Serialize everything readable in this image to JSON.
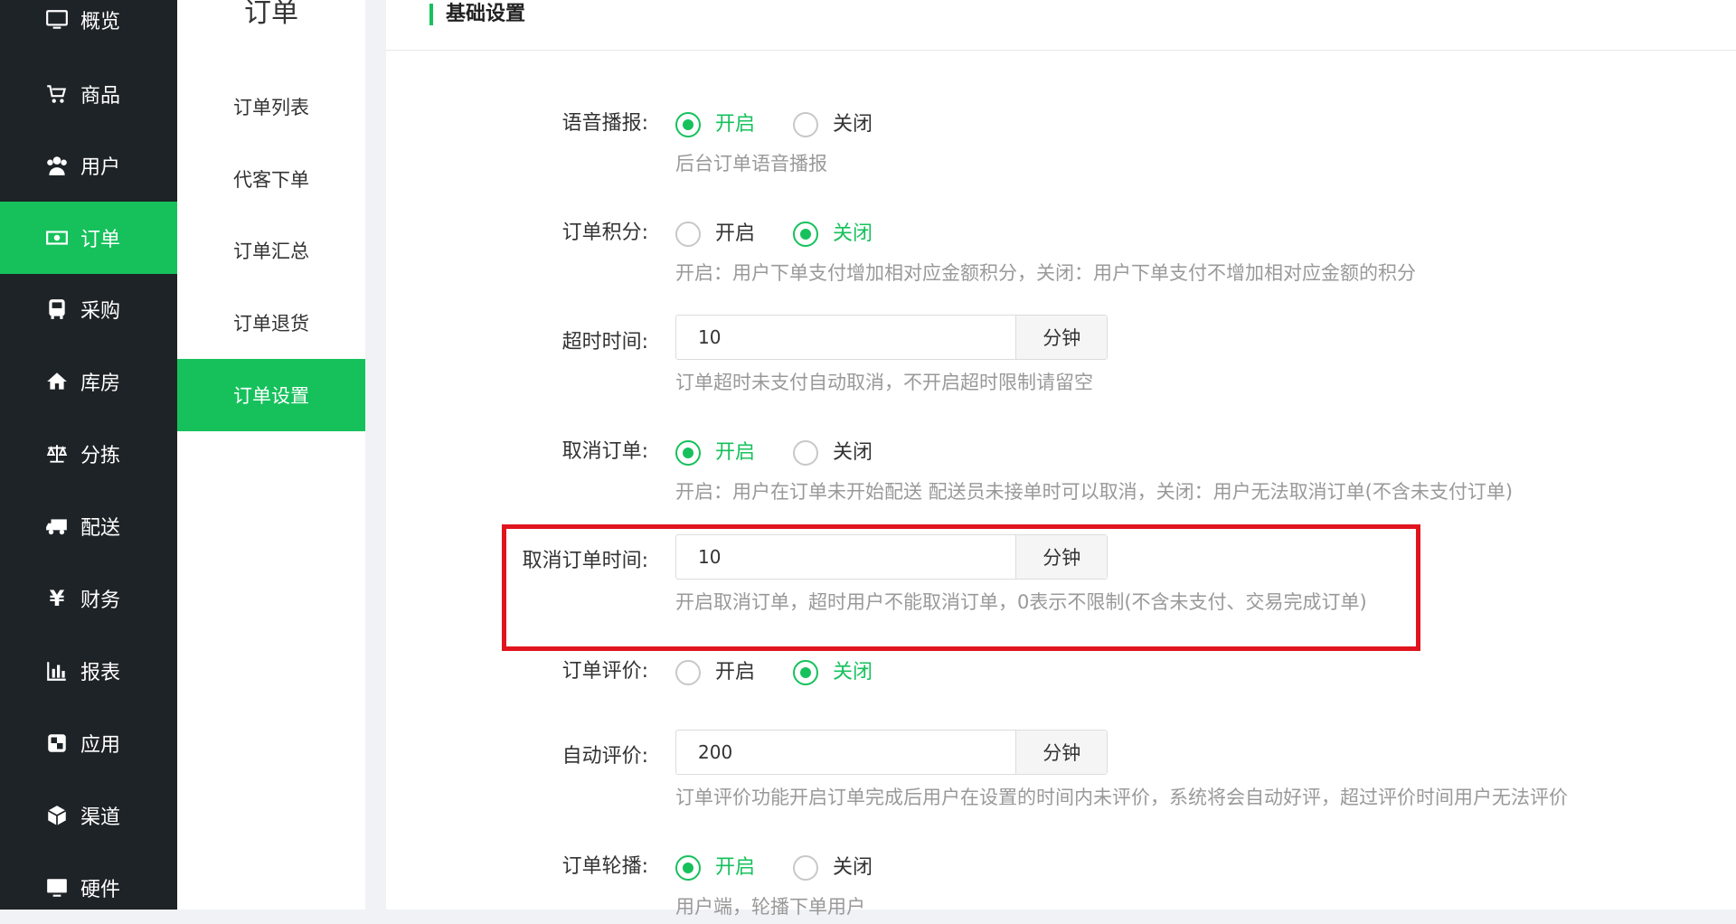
{
  "nav": {
    "items": [
      {
        "label": "概览",
        "icon": "monitor-icon"
      },
      {
        "label": "商品",
        "icon": "cart-icon"
      },
      {
        "label": "用户",
        "icon": "users-icon"
      },
      {
        "label": "订单",
        "icon": "money-icon"
      },
      {
        "label": "采购",
        "icon": "bus-icon"
      },
      {
        "label": "库房",
        "icon": "home-icon"
      },
      {
        "label": "分拣",
        "icon": "scale-icon"
      },
      {
        "label": "配送",
        "icon": "truck-icon"
      },
      {
        "label": "财务",
        "icon": "yen-icon"
      },
      {
        "label": "报表",
        "icon": "bar-chart-icon"
      },
      {
        "label": "应用",
        "icon": "app-icon"
      },
      {
        "label": "渠道",
        "icon": "cube-icon"
      },
      {
        "label": "硬件",
        "icon": "monitor-icon"
      }
    ],
    "active": "订单",
    "accent": "#16c15c"
  },
  "subnav": {
    "title": "订单",
    "items": [
      {
        "label": "订单列表"
      },
      {
        "label": "代客下单"
      },
      {
        "label": "订单汇总"
      },
      {
        "label": "订单退货"
      },
      {
        "label": "订单设置"
      }
    ],
    "active": "订单设置"
  },
  "section": {
    "title": "基础设置"
  },
  "settings": {
    "voice": {
      "label": "语音播报:",
      "on": "开启",
      "off": "关闭",
      "selected": "开启",
      "hint": "后台订单语音播报"
    },
    "points": {
      "label": "订单积分:",
      "on": "开启",
      "off": "关闭",
      "selected": "关闭",
      "hint": "开启：用户下单支付增加相对应金额积分，关闭：用户下单支付不增加相对应金额的积分"
    },
    "timeout": {
      "label": "超时时间:",
      "value": "10",
      "unit": "分钟",
      "hint": "订单超时未支付自动取消，不开启超时限制请留空"
    },
    "cancel": {
      "label": "取消订单:",
      "on": "开启",
      "off": "关闭",
      "selected": "开启",
      "hint": "开启：用户在订单未开始配送 配送员未接单时可以取消，关闭：用户无法取消订单(不含未支付订单)"
    },
    "cancel_time": {
      "label": "取消订单时间:",
      "value": "10",
      "unit": "分钟",
      "hint": "开启取消订单，超时用户不能取消订单，0表示不限制(不含未支付、交易完成订单)"
    },
    "review": {
      "label": "订单评价:",
      "on": "开启",
      "off": "关闭",
      "selected": "关闭"
    },
    "auto_review": {
      "label": "自动评价:",
      "value": "200",
      "unit": "分钟",
      "hint": "订单评价功能开启订单完成后用户在设置的时间内未评价，系统将会自动好评，超过评价时间用户无法评价"
    },
    "carousel": {
      "label": "订单轮播:",
      "on": "开启",
      "off": "关闭",
      "selected": "开启",
      "hint": "用户端，轮播下单用户"
    }
  },
  "highlight_color": "#e0141e"
}
